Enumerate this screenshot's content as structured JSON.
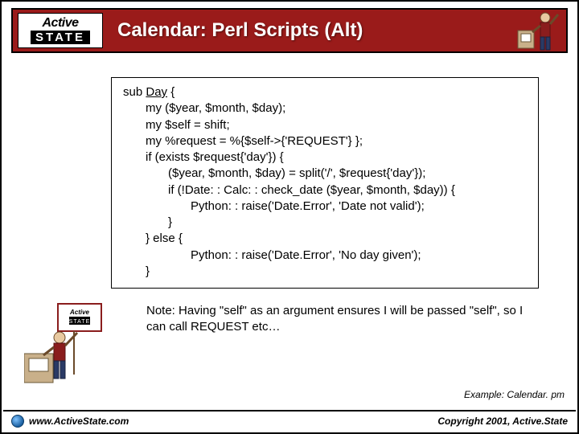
{
  "logo": {
    "line1": "Active",
    "line2": "STATE"
  },
  "title": "Calendar: Perl Scripts (Alt)",
  "code": {
    "l1a": "sub",
    "l1b": "Day",
    "l1c": " {",
    "l2": "my ($year, $month, $day);",
    "l3": "my $self = shift;",
    "l4": "my %request = %{$self->{'REQUEST'} };",
    "l5": "if (exists $request{'day'}) {",
    "l6": "($year, $month, $day) = split('/', $request{'day'});",
    "l7": "if (!Date: : Calc: : check_date ($year, $month, $day)) {",
    "l8": "Python: : raise('Date.Error', 'Date not valid');",
    "l9": "}",
    "l10": "} else {",
    "l11": "Python: : raise('Date.Error', 'No day given');",
    "l12": "}"
  },
  "note": "Note: Having \"self\" as an argument ensures I will be passed \"self\", so I can call REQUEST etc…",
  "example": "Example: Calendar. pm",
  "footer": {
    "url": "www.ActiveState.com",
    "copyright": "Copyright 2001, Active.State"
  }
}
